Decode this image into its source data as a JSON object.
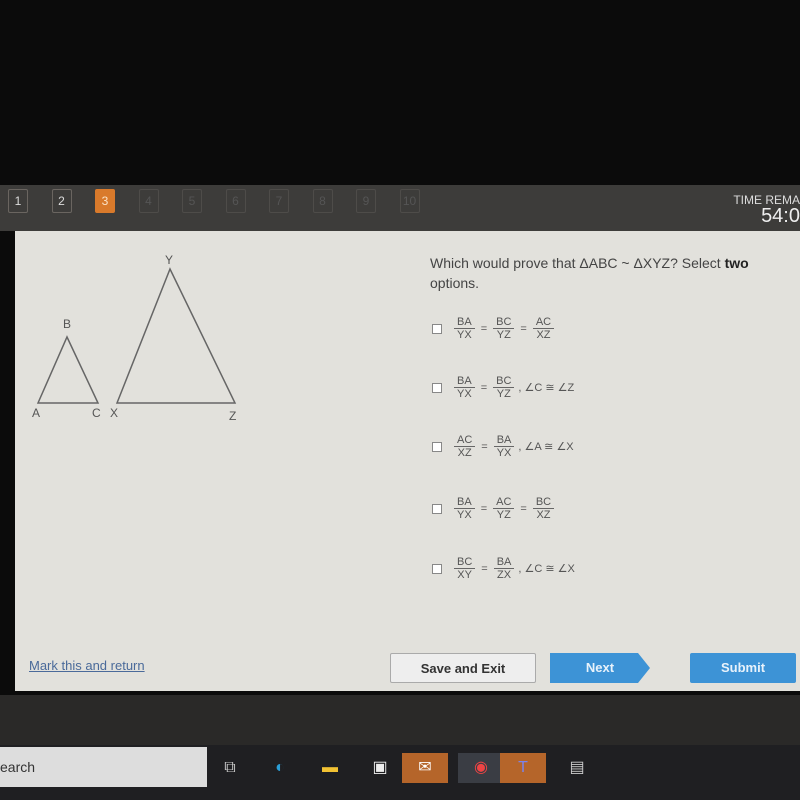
{
  "nav": {
    "questions": [
      "1",
      "2",
      "3",
      "4",
      "5",
      "6",
      "7",
      "8",
      "9",
      "10"
    ],
    "current": 3,
    "timer_label": "TIME REMA",
    "timer_value": "54:0"
  },
  "figure": {
    "labels": {
      "A": "A",
      "B": "B",
      "C": "C",
      "X": "X",
      "Y": "Y",
      "Z": "Z"
    }
  },
  "question": {
    "text": "Which would prove that ΔABC ~ ΔXYZ? Select ",
    "bold": "two",
    "text2": " options."
  },
  "options": [
    {
      "fracs": [
        [
          "BA",
          "YX"
        ],
        [
          "BC",
          "YZ"
        ],
        [
          "AC",
          "XZ"
        ]
      ],
      "angle": ""
    },
    {
      "fracs": [
        [
          "BA",
          "YX"
        ],
        [
          "BC",
          "YZ"
        ]
      ],
      "angle": ", ∠C ≅ ∠Z"
    },
    {
      "fracs": [
        [
          "AC",
          "XZ"
        ],
        [
          "BA",
          "YX"
        ]
      ],
      "angle": ", ∠A ≅ ∠X"
    },
    {
      "fracs": [
        [
          "BA",
          "YX"
        ],
        [
          "AC",
          "YZ"
        ],
        [
          "BC",
          "XZ"
        ]
      ],
      "angle": ""
    },
    {
      "fracs": [
        [
          "BC",
          "XY"
        ],
        [
          "BA",
          "ZX"
        ]
      ],
      "angle": ", ∠C ≅ ∠X"
    }
  ],
  "footer": {
    "mark": "Mark this and return",
    "save": "Save and Exit",
    "next": "Next",
    "submit": "Submit"
  },
  "taskbar": {
    "search": "earch",
    "icons": [
      "task-view",
      "edge",
      "file-explorer",
      "store",
      "mail",
      "chrome",
      "teams",
      "app"
    ]
  }
}
